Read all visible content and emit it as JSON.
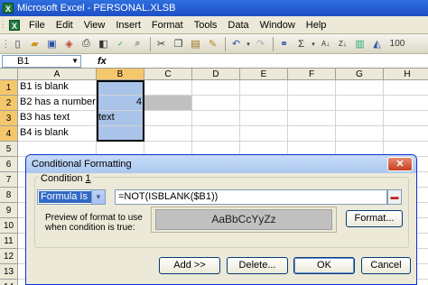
{
  "window": {
    "title": "Microsoft Excel - PERSONAL.XLSB"
  },
  "menu": {
    "items": [
      "File",
      "Edit",
      "View",
      "Insert",
      "Format",
      "Tools",
      "Data",
      "Window",
      "Help"
    ]
  },
  "toolbar": {
    "icons": [
      "new-icon",
      "open-icon",
      "save-icon",
      "permission-icon",
      "print-icon",
      "print-preview-icon",
      "spelling-icon",
      "research-icon",
      "cut-icon",
      "copy-icon",
      "paste-icon",
      "format-painter-icon",
      "undo-icon",
      "redo-icon",
      "hyperlink-icon",
      "autosum-icon",
      "sort-ascending-icon",
      "sort-descending-icon",
      "chart-wizard-icon",
      "drawing-icon",
      "zoom-icon"
    ],
    "zoom": "100"
  },
  "formula_bar": {
    "name_box": "B1",
    "fx": "fx",
    "content": ""
  },
  "columns": [
    "A",
    "B",
    "C",
    "D",
    "E",
    "F",
    "G",
    "H"
  ],
  "rows": [
    "1",
    "2",
    "3",
    "4",
    "5",
    "6",
    "7",
    "8",
    "9",
    "10",
    "11",
    "12",
    "13",
    "14"
  ],
  "cells": {
    "A1": "B1 is blank",
    "A2": "B2 has a number",
    "A3": "B3 has text",
    "A4": "B4 is blank",
    "B2": "4",
    "B3": "text"
  },
  "dialog": {
    "title": "Conditional Formatting",
    "condition_label": "Condition",
    "condition_number": "1",
    "condition_type": "Formula Is",
    "formula": "=NOT(ISBLANK($B1))",
    "preview_label": "Preview of format to use when condition is true:",
    "preview_text": "AaBbCcYyZz",
    "format_button": "Format...",
    "add_button": "Add >>",
    "delete_button": "Delete...",
    "ok_button": "OK",
    "cancel_button": "Cancel"
  }
}
